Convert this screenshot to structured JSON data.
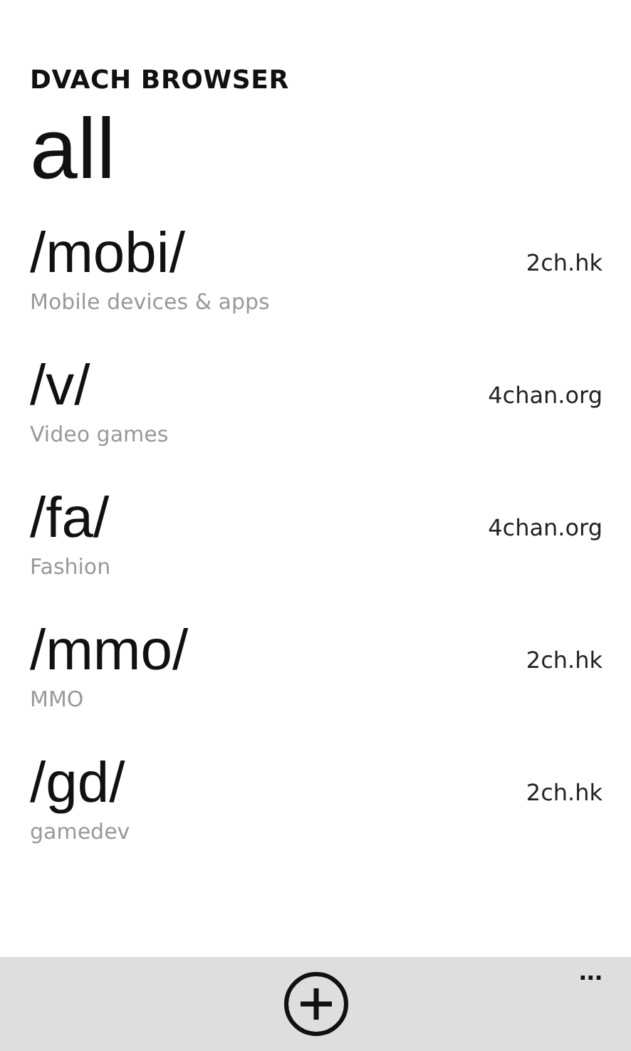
{
  "app_title": "DVACH BROWSER",
  "page_title": "all",
  "boards": [
    {
      "name": "/mobi/",
      "description": "Mobile devices & apps",
      "site": "2ch.hk"
    },
    {
      "name": "/v/",
      "description": "Video games",
      "site": "4chan.org"
    },
    {
      "name": "/fa/",
      "description": "Fashion",
      "site": "4chan.org"
    },
    {
      "name": "/mmo/",
      "description": "MMO",
      "site": "2ch.hk"
    },
    {
      "name": "/gd/",
      "description": "gamedev",
      "site": "2ch.hk"
    }
  ],
  "app_bar": {
    "more": "..."
  }
}
